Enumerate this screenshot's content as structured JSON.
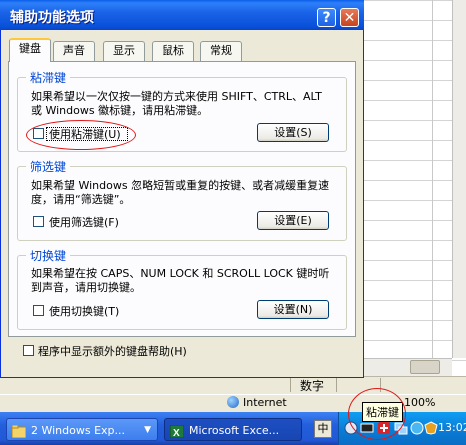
{
  "dialog": {
    "title": "辅助功能选项",
    "help_label": "?",
    "close_label": "✕",
    "tabs": [
      {
        "label": "键盘",
        "selected": true
      },
      {
        "label": "声音",
        "selected": false
      },
      {
        "label": "显示",
        "selected": false
      },
      {
        "label": "鼠标",
        "selected": false
      },
      {
        "label": "常规",
        "selected": false
      }
    ],
    "sticky": {
      "heading": "粘滞键",
      "desc": "如果希望以一次仅按一键的方式来使用 SHIFT、CTRL、ALT 或 Windows 徽标键，请用粘滞键。",
      "checkbox_label": "使用粘滞键(U)",
      "settings_label": "设置(S)"
    },
    "filter": {
      "heading": "筛选键",
      "desc": "如果希望 Windows 忽略短暂或重复的按键、或者减缓重复速度，请用“筛选键”。",
      "checkbox_label": "使用筛选键(F)",
      "settings_label": "设置(E)"
    },
    "toggle": {
      "heading": "切换键",
      "desc": "如果希望在按 CAPS、NUM LOCK 和 SCROLL LOCK 键时听到声音，请用切换键。",
      "checkbox_label": "使用切换键(T)",
      "settings_label": "设置(N)"
    },
    "extra_help_label": "程序中显示额外的键盘帮助(H)"
  },
  "excel_status": {
    "num": "数字"
  },
  "ie_status": {
    "zone": "Internet",
    "zoom": "100%"
  },
  "taskbar": {
    "buttons": [
      {
        "label": "2 Windows Exp..."
      },
      {
        "label": "Microsoft Exce..."
      }
    ],
    "ime_label": "中",
    "clock": "13:02"
  },
  "tooltip": "粘滞键"
}
